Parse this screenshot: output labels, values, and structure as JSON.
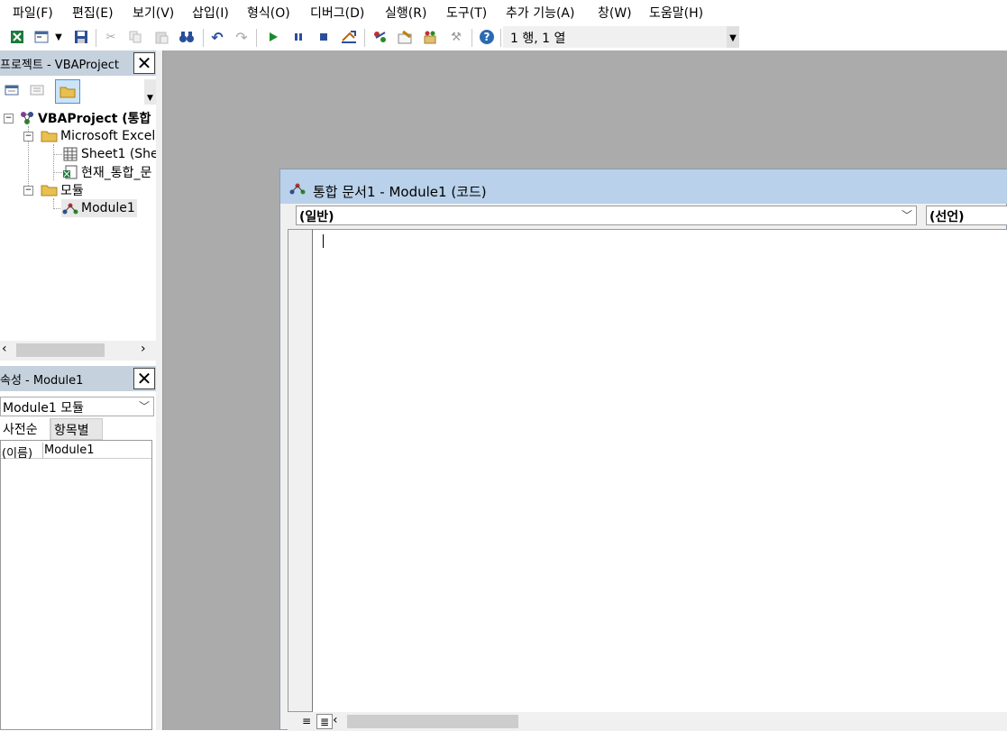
{
  "menu": {
    "items": [
      {
        "label": "파일(F)"
      },
      {
        "label": "편집(E)"
      },
      {
        "label": "보기(V)"
      },
      {
        "label": "삽입(I)"
      },
      {
        "label": "형식(O)"
      },
      {
        "label": "디버그(D)"
      },
      {
        "label": "실행(R)"
      },
      {
        "label": "도구(T)"
      },
      {
        "label": "추가 기능(A)"
      },
      {
        "label": "창(W)"
      },
      {
        "label": "도움말(H)"
      }
    ]
  },
  "toolbar": {
    "status": "1 행, 1 열",
    "icons": [
      "excel-icon",
      "insert-userform-icon",
      "save-icon",
      "cut-icon",
      "copy-icon",
      "paste-icon",
      "find-icon",
      "undo-icon",
      "redo-icon",
      "run-icon",
      "break-icon",
      "reset-icon",
      "design-mode-icon",
      "project-explorer-icon",
      "properties-window-icon",
      "object-browser-icon",
      "toolbox-icon",
      "help-icon"
    ]
  },
  "project_pane": {
    "title": "프로젝트 - VBAProject",
    "tree": {
      "root": "VBAProject (통합",
      "objects_folder": "Microsoft Excel",
      "sheet": "Sheet1 (She",
      "workbook": "현재_통합_문",
      "modules_folder": "모듈",
      "module": "Module1"
    }
  },
  "properties_pane": {
    "title": "속성 - Module1",
    "object": "Module1 모듈",
    "tabs": [
      "사전순",
      "항목별"
    ],
    "rows": [
      {
        "key": "(이름)",
        "value": "Module1"
      }
    ]
  },
  "code_window": {
    "title": "통합 문서1 - Module1 (코드)",
    "object_combo": "(일반)",
    "procedure_combo": "(선언)"
  }
}
